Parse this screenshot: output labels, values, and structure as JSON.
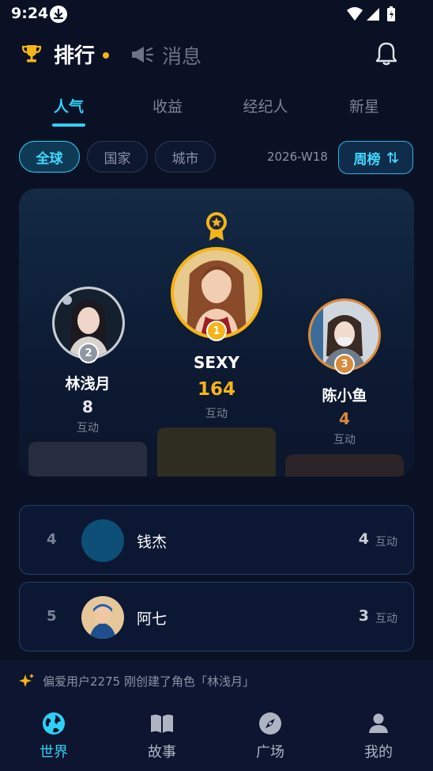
{
  "status_bar": {
    "time": "9:24"
  },
  "header": {
    "rank_title": "排行",
    "messages_title": "消息"
  },
  "category_tabs": [
    {
      "label": "人气",
      "active": true
    },
    {
      "label": "收益",
      "active": false
    },
    {
      "label": "经纪人",
      "active": false
    },
    {
      "label": "新星",
      "active": false
    }
  ],
  "scope_filters": [
    {
      "label": "全球",
      "active": true
    },
    {
      "label": "国家",
      "active": false
    },
    {
      "label": "城市",
      "active": false
    }
  ],
  "period": {
    "week": "2026-W18",
    "toggle_label": "周榜"
  },
  "podium": {
    "first": {
      "name": "SEXY",
      "score": "164",
      "unit": "互动",
      "rank": "1"
    },
    "second": {
      "name": "林浅月",
      "score": "8",
      "unit": "互动",
      "rank": "2"
    },
    "third": {
      "name": "陈小鱼",
      "score": "4",
      "unit": "互动",
      "rank": "3"
    }
  },
  "list": [
    {
      "rank": "4",
      "name": "钱杰",
      "score": "4",
      "unit": "互动"
    },
    {
      "rank": "5",
      "name": "阿七",
      "score": "3",
      "unit": "互动"
    }
  ],
  "notice": {
    "text": "偏爱用户2275 刚创建了角色「林浅月」"
  },
  "bottom_nav": [
    {
      "label": "世界",
      "icon": "globe-icon",
      "active": true
    },
    {
      "label": "故事",
      "icon": "book-icon",
      "active": false
    },
    {
      "label": "广场",
      "icon": "compass-icon",
      "active": false
    },
    {
      "label": "我的",
      "icon": "person-icon",
      "active": false
    }
  ],
  "colors": {
    "accent": "#2fd0f5",
    "gold": "#f5b417",
    "silver": "#c8ccd4",
    "bronze": "#d98a3c",
    "background": "#0a1124"
  }
}
